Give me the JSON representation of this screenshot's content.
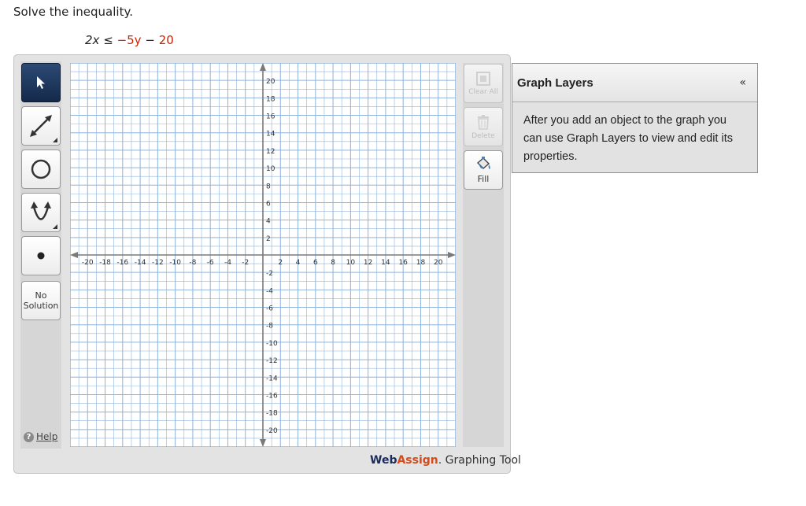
{
  "prompt": "Solve the inequality.",
  "inequality": {
    "lhs": "2x",
    "relation": "≤",
    "rhs_coef": "−5y",
    "minus": "−",
    "constant": "20"
  },
  "toolbar": {
    "tools": [
      {
        "name": "select-tool",
        "icon": "arrow-cursor-icon"
      },
      {
        "name": "line-tool",
        "icon": "double-arrow-line-icon"
      },
      {
        "name": "circle-tool",
        "icon": "circle-icon"
      },
      {
        "name": "parabola-tool",
        "icon": "parabola-icon"
      },
      {
        "name": "point-tool",
        "icon": "point-icon"
      }
    ],
    "no_solution_line1": "No",
    "no_solution_line2": "Solution",
    "help_label": "Help"
  },
  "right_toolbar": {
    "clear_all_label": "Clear All",
    "delete_label": "Delete",
    "fill_label": "Fill"
  },
  "graph": {
    "x_range": [
      -22,
      22
    ],
    "y_range": [
      -22,
      22
    ],
    "x_tick_labels": [
      "-20",
      "-18",
      "-16",
      "-14",
      "-12",
      "-10",
      "-8",
      "-6",
      "-4",
      "-2",
      "2",
      "4",
      "6",
      "8",
      "10",
      "12",
      "14",
      "16",
      "18",
      "20"
    ],
    "y_tick_labels": [
      "20",
      "18",
      "16",
      "14",
      "12",
      "10",
      "8",
      "6",
      "4",
      "2",
      "-2",
      "-4",
      "-6",
      "-8",
      "-10",
      "-12",
      "-14",
      "-16",
      "-18",
      "-20"
    ],
    "grid_color": "#8fb3d9",
    "axis_color": "#7a7a7a"
  },
  "brand": {
    "web": "Web",
    "assign": "Assign",
    "suffix": ". Graphing Tool"
  },
  "layers": {
    "title": "Graph Layers",
    "collapse_symbol": "«",
    "body": "After you add an object to the graph you can use Graph Layers to view and edit its properties."
  }
}
